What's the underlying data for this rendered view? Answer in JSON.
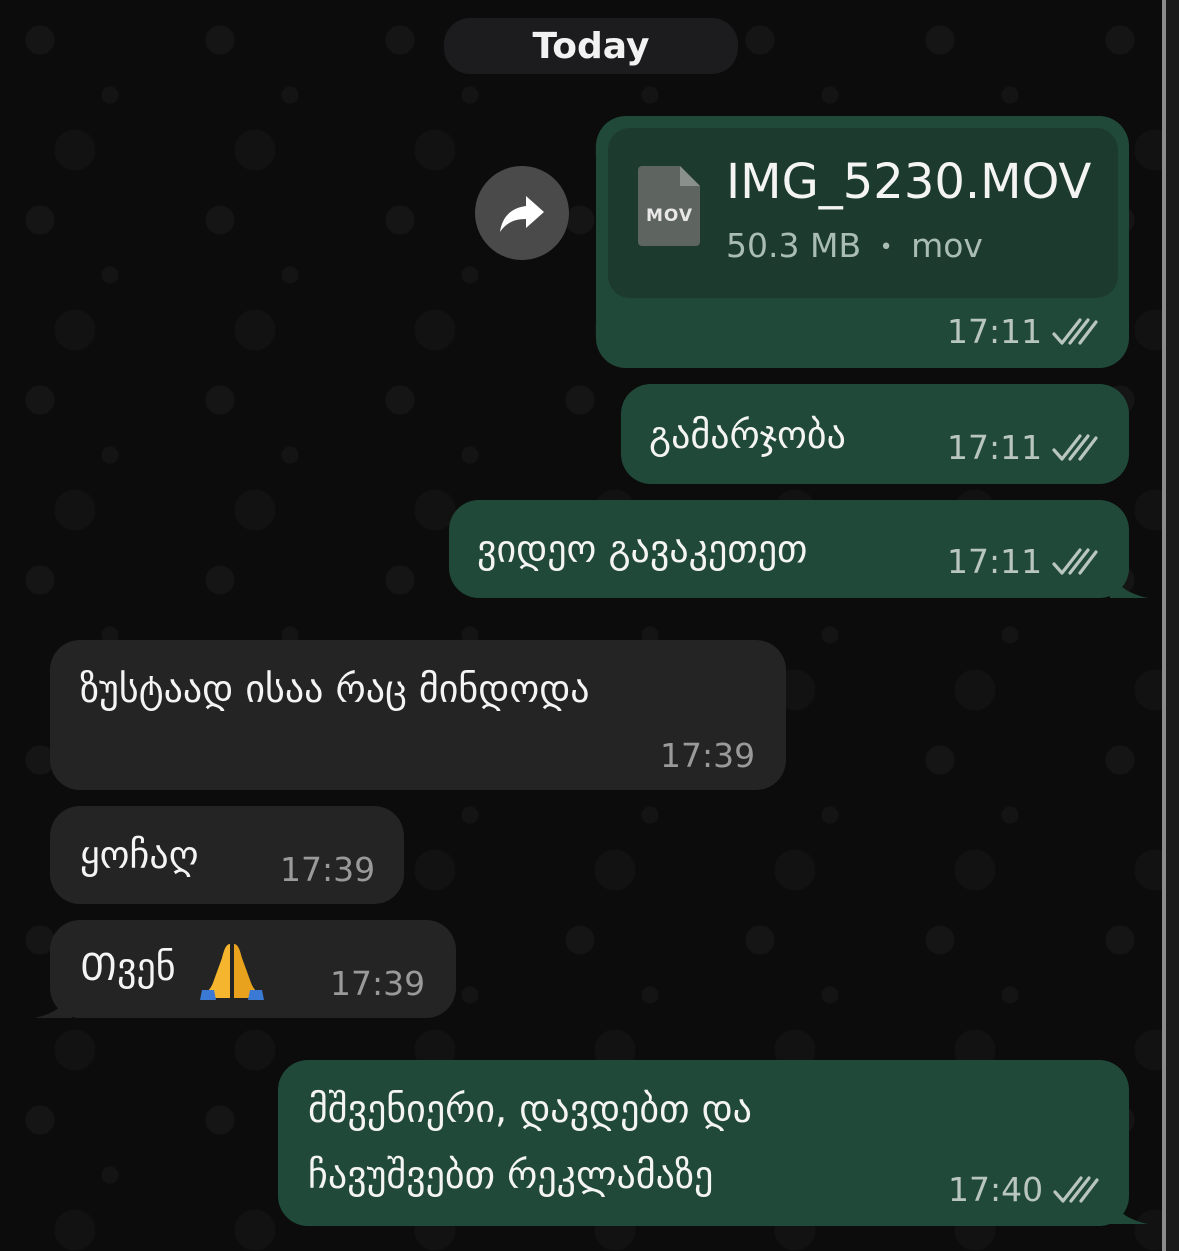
{
  "date_divider": "Today",
  "file_message": {
    "file_name": "IMG_5230.MOV",
    "file_type_badge": "MOV",
    "file_size": "50.3 MB",
    "separator": "•",
    "file_ext": "mov",
    "time": "17:11",
    "status": "read"
  },
  "messages": [
    {
      "direction": "outgoing",
      "text": "გამარჯობა",
      "time": "17:11",
      "status": "read"
    },
    {
      "direction": "outgoing",
      "text": "ვიდეო გავაკეთეთ",
      "time": "17:11",
      "status": "read"
    },
    {
      "direction": "incoming",
      "text": "ზუსტაად ისაა რაც მინდოდა",
      "time": "17:39"
    },
    {
      "direction": "incoming",
      "text": "ყოჩაღ",
      "time": "17:39"
    },
    {
      "direction": "incoming",
      "text": "Თვენ",
      "emoji": "folded-hands",
      "time": "17:39"
    },
    {
      "direction": "outgoing",
      "text_line1": "მშვენიერი, დავდებთ და",
      "text_line2": "ჩავუშვებთ რეკლამაზე",
      "time": "17:40",
      "status": "read"
    }
  ],
  "icons": {
    "forward": "forward-arrow-icon",
    "file": "document-icon",
    "read_receipt": "double-check-icon"
  },
  "colors": {
    "outgoing_bubble": "#20493a",
    "incoming_bubble": "#242424",
    "background": "#0c0c0c",
    "file_card": "#1c3a2e"
  }
}
